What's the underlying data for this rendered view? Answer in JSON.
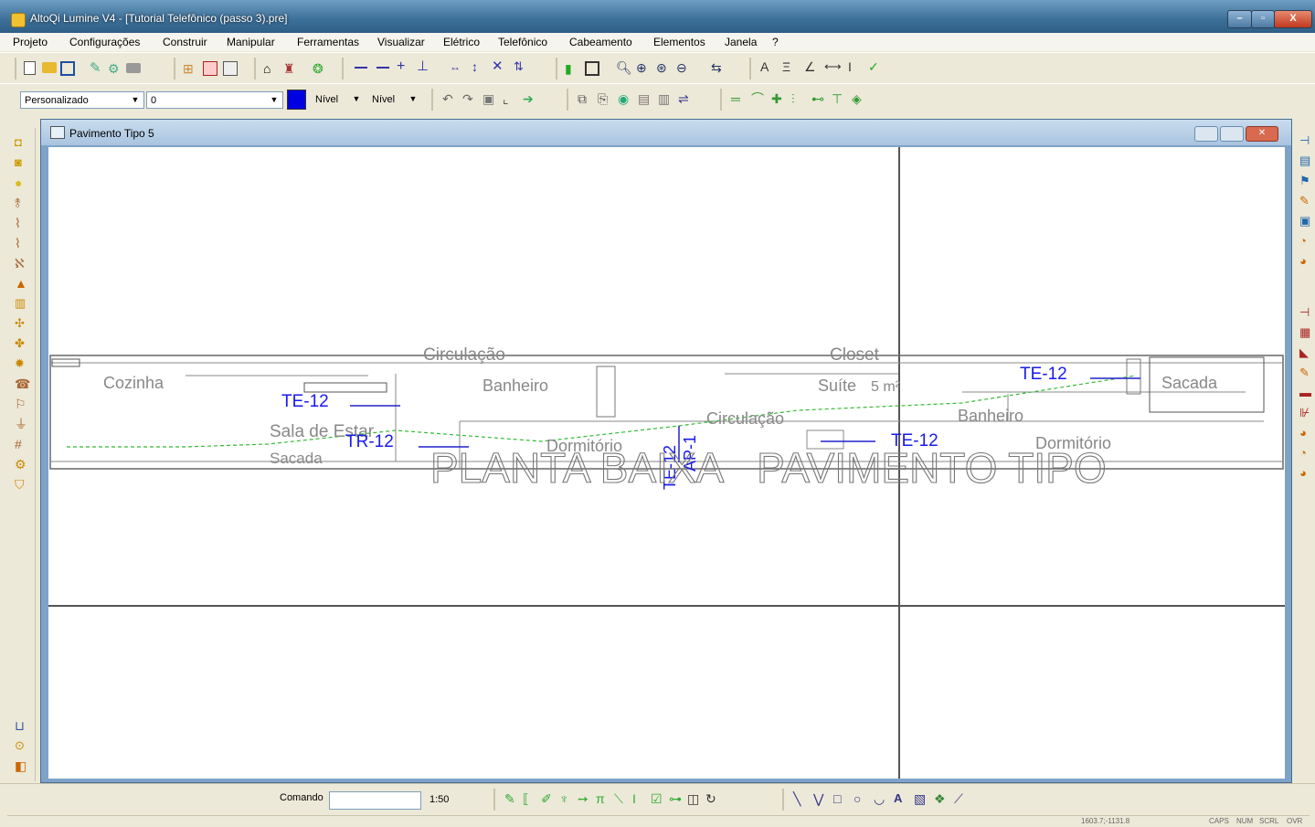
{
  "window": {
    "title": "AltoQi Lumine V4 - [Tutorial Telefônico (passo 3).pre]",
    "minimize": "–",
    "maximize": "▫",
    "close": "X"
  },
  "menu": [
    "Projeto",
    "Configurações",
    "Construir",
    "Manipular",
    "Ferramentas",
    "Visualizar",
    "Elétrico",
    "Telefônico",
    "Cabeamento",
    "Elementos",
    "Janela",
    "?"
  ],
  "toolbar2": {
    "style_combo": "Personalizado",
    "layer_combo": "0",
    "color": "#0000e0",
    "nivel1": "Nível",
    "nivel2": "Nível"
  },
  "document": {
    "title": "Pavimento Tipo 5",
    "rooms": [
      "Circulação",
      "Cozinha",
      "Banheiro",
      "Closet",
      "Suíte",
      "Sacada",
      "Sala de Estar",
      "Sacada",
      "Dormitório",
      "Circulação",
      "Banheiro",
      "Dormitório"
    ],
    "area_label": "5 m²",
    "labels": [
      "TE-12",
      "TR-12",
      "TE-12",
      "AP-1",
      "TE-12",
      "TE-12"
    ],
    "plan_title": "PLANTA BAIXA   PAVIMENTO TIPO"
  },
  "status": {
    "command_label": "Comando",
    "command_value": "",
    "scale": "1:50",
    "coords": "1603.7;-1131.8",
    "indicators": [
      "CAPS",
      "NUM",
      "SCRL",
      "OVR"
    ]
  }
}
